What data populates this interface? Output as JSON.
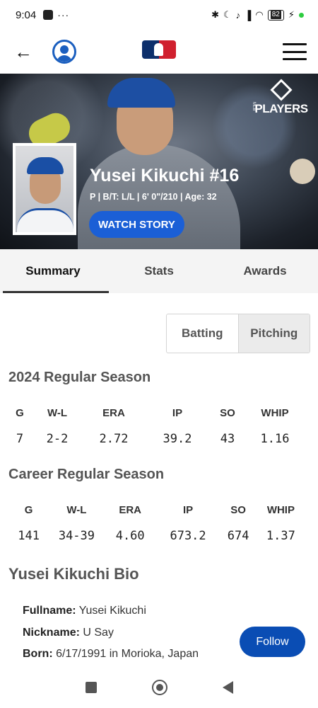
{
  "status_bar": {
    "time": "9:04",
    "dots": "···",
    "battery": "82",
    "icons": [
      "bluetooth-icon",
      "moon-icon",
      "mute-icon",
      "signal-icon",
      "wifi-icon",
      "battery-icon",
      "charging-icon"
    ]
  },
  "header": {
    "back_icon": "←",
    "icons": [
      "back-arrow-icon",
      "account-icon",
      "mlb-logo",
      "hamburger-menu-icon"
    ]
  },
  "hero": {
    "player_name": "Yusei Kikuchi #16",
    "meta": "P | B/T: L/L | 6' 0\"/210 | Age: 32",
    "watch_button": "WATCH STORY",
    "players_logo": "PLAYERS",
    "players_logo_small": "MLB"
  },
  "tabs": [
    {
      "label": "Summary",
      "active": true
    },
    {
      "label": "Stats",
      "active": false
    },
    {
      "label": "Awards",
      "active": false
    }
  ],
  "toggle": {
    "batting": "Batting",
    "pitching": "Pitching",
    "selected": "Pitching"
  },
  "season": {
    "title": "2024 Regular Season",
    "headers": [
      "G",
      "W-L",
      "ERA",
      "IP",
      "SO",
      "WHIP"
    ],
    "values": [
      "7",
      "2-2",
      "2.72",
      "39.2",
      "43",
      "1.16"
    ]
  },
  "career": {
    "title": "Career Regular Season",
    "headers": [
      "G",
      "W-L",
      "ERA",
      "IP",
      "SO",
      "WHIP"
    ],
    "values": [
      "141",
      "34-39",
      "4.60",
      "673.2",
      "674",
      "1.37"
    ]
  },
  "bio": {
    "title": "Yusei Kikuchi Bio",
    "fullname_label": "Fullname:",
    "fullname": "Yusei Kikuchi",
    "nickname_label": "Nickname:",
    "nickname": "U Say",
    "born_label": "Born:",
    "born": "6/17/1991 in Morioka, Japan"
  },
  "follow_button": "Follow",
  "colors": {
    "accent": "#1b5fd6",
    "follow": "#0a4db4"
  }
}
